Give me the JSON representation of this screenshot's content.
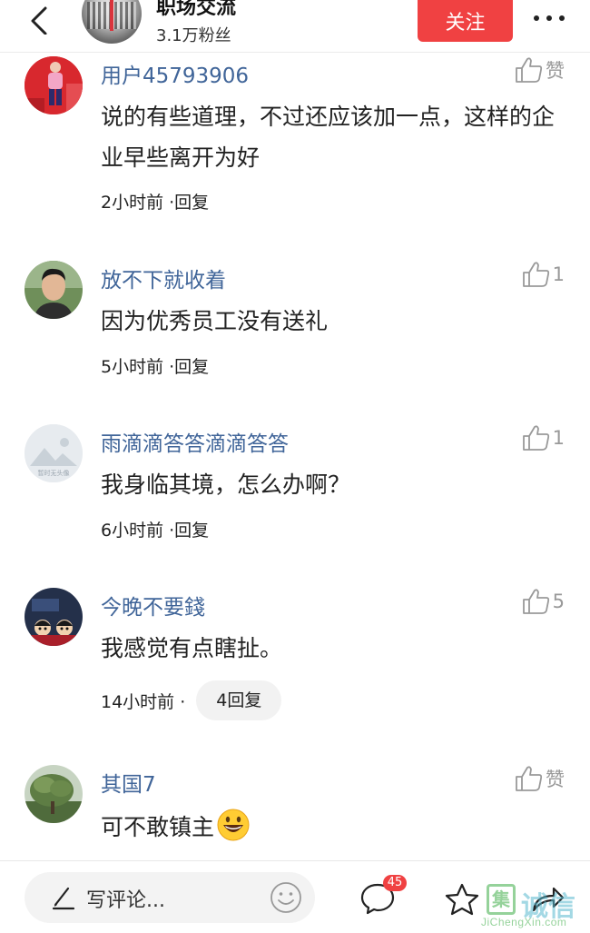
{
  "header": {
    "title": "职场交流",
    "followers": "3.1万粉丝",
    "follow_label": "关注"
  },
  "comments": [
    {
      "name": "用户45793906",
      "text": "说的有些道理，不过还应该加一点，这样的企业早些离开为好",
      "time": "2小时前 · ",
      "reply": "回复",
      "likes": "赞",
      "avatar": "person-red-background"
    },
    {
      "name": "放不下就收着",
      "text": "因为优秀员工没有送礼",
      "time": "5小时前 · ",
      "reply": "回复",
      "likes": "1",
      "avatar": "young-man-portrait"
    },
    {
      "name": "雨滴滴答答滴滴答答",
      "text": "我身临其境，怎么办啊？",
      "time": "6小时前 · ",
      "reply": "回复",
      "likes": "1",
      "avatar": "default-mountain-placeholder",
      "avatar_caption": "暂时无头像"
    },
    {
      "name": "今晚不要錢",
      "text": "我感觉有点瞎扯。",
      "time": "14小时前 · ",
      "reply": "4回复",
      "likes": "5",
      "avatar": "cartoon-characters"
    },
    {
      "name": "其国7",
      "text": "可不敢镇主",
      "time": "",
      "reply": "",
      "likes": "赞",
      "avatar": "tree-landscape",
      "emoji": "grinning-face-emoji"
    }
  ],
  "bottombar": {
    "input_placeholder": "写评论...",
    "comment_count": "45"
  },
  "watermark": {
    "cn": "诚信",
    "box_char": "集",
    "url": "JiChengXin.com"
  },
  "colors": {
    "accent": "#f04142",
    "name_blue": "#406599",
    "like_gray": "#999999"
  }
}
